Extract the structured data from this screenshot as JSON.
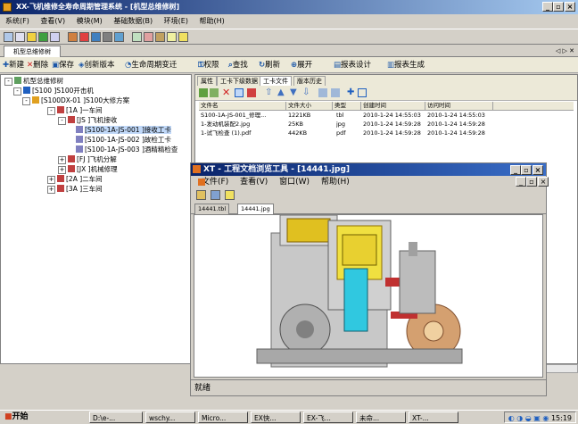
{
  "app": {
    "title": "XX-飞机维修全寿命周期管理系统 - [机型总维修树]",
    "menu": [
      "系统(F)",
      "查看(V)",
      "模块(M)",
      "基础数据(B)",
      "环境(E)",
      "帮助(H)"
    ],
    "doc_tab": "机型总维修树",
    "commands": [
      {
        "icon": "new-icon",
        "label": "新建"
      },
      {
        "icon": "delete-icon",
        "label": "删除"
      },
      {
        "icon": "save-icon",
        "label": "保存"
      },
      {
        "icon": "new-version-icon",
        "label": "创新版本"
      },
      {
        "icon": "lifecycle-icon",
        "label": "生命周期变迁"
      },
      {
        "icon": "permission-icon",
        "label": "权限"
      },
      {
        "icon": "find-icon",
        "label": "查找"
      },
      {
        "icon": "refresh-icon",
        "label": "刷新"
      },
      {
        "icon": "expand-icon",
        "label": "展开"
      },
      {
        "icon": "report-design-icon",
        "label": "报表设计"
      },
      {
        "icon": "report-generate-icon",
        "label": "报表生成"
      }
    ],
    "panel_nav": "◁ ▷ ✕"
  },
  "tree": {
    "nodes": [
      {
        "label": "机型总维修树",
        "level": 0,
        "expander": "-"
      },
      {
        "label": "[S100 ]S100开击机",
        "level": 1,
        "expander": "-"
      },
      {
        "label": "[S100DX-01 ]S100大修方案",
        "level": 2,
        "expander": "-"
      },
      {
        "label": "[1A ]一车间",
        "level": 3,
        "expander": "-"
      },
      {
        "label": "[JS ]飞机接收",
        "level": 4,
        "expander": "-"
      },
      {
        "label": "[S100-1A-JS-001 ]接收工卡",
        "level": 5,
        "expander": ""
      },
      {
        "label": "[S100-1A-JS-002 ]故检工卡",
        "level": 5,
        "expander": ""
      },
      {
        "label": "[S100-1A-JS-003 ]酒精精检查",
        "level": 5,
        "expander": ""
      },
      {
        "label": "[FJ ]飞机分解",
        "level": 4,
        "expander": "+"
      },
      {
        "label": "[JX ]机械修理",
        "level": 4,
        "expander": "+"
      },
      {
        "label": "[2A ]二车间",
        "level": 3,
        "expander": "+"
      },
      {
        "label": "[3A ]三车间",
        "level": 3,
        "expander": "+"
      }
    ]
  },
  "right_panel": {
    "subtabs": [
      "属性",
      "工卡下级数据",
      "工卡文件",
      "版本历史"
    ],
    "active_subtab": 2,
    "columns": [
      "文件名",
      "文件大小",
      "类型",
      "创建时间",
      "访问时间"
    ],
    "rows": [
      [
        "S100-1A-JS-001_修理...",
        "1221KB",
        "tbl",
        "2010-1-24 14:55:03",
        "2010-1-24 14:55:03"
      ],
      [
        "1-发动机装配2.jpg",
        "25KB",
        "jpg",
        "2010-1-24 14:59:28",
        "2010-1-24 14:59:28"
      ],
      [
        "1-试飞检查 (1).pdf",
        "442KB",
        "pdf",
        "2010-1-24 14:59:28",
        "2010-1-24 14:59:28"
      ]
    ]
  },
  "viewer": {
    "title": "XT - 工程文档浏览工具 - [14441.jpg]",
    "menu": [
      "文件(F)",
      "查看(V)",
      "窗口(W)",
      "帮助(H)"
    ],
    "tabs": [
      "14441.tbl",
      "14441.jpg"
    ],
    "active_tab": 1,
    "status": "就绪"
  },
  "taskbar": {
    "start": "开始",
    "buttons": [
      "D:\\e-...",
      "wschy...",
      "Micro...",
      "EX快...",
      "EX-飞...",
      "未命...",
      "XT-..."
    ],
    "clock": "15:19"
  }
}
